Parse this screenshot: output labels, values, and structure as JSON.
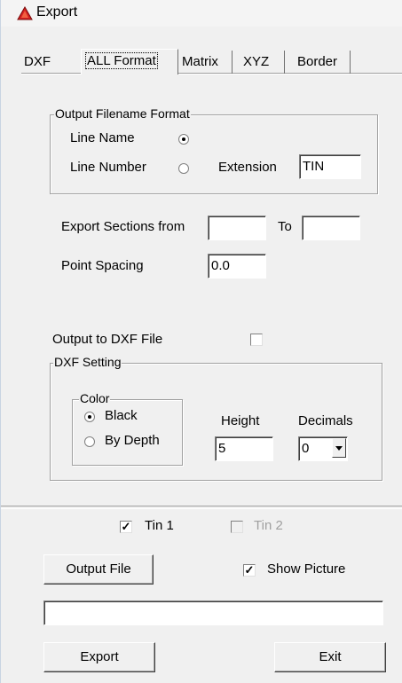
{
  "window": {
    "title": "Export",
    "icon": "triangle-app-icon"
  },
  "tabs": [
    "DXF",
    "ALL Format",
    "Matrix",
    "XYZ",
    "Border"
  ],
  "active_tab": "ALL Format",
  "output_filename_format": {
    "legend": "Output Filename Format",
    "line_name_label": "Line Name",
    "line_number_label": "Line Number",
    "selected": "Line Name",
    "extension_label": "Extension",
    "extension_value": "TIN"
  },
  "export_sections": {
    "label": "Export Sections from",
    "from_value": "",
    "to_label": "To",
    "to_value": ""
  },
  "point_spacing": {
    "label": "Point Spacing",
    "value": "0.0"
  },
  "output_dxf": {
    "label": "Output to DXF File",
    "checked": false
  },
  "dxf_setting": {
    "legend": "DXF Setting",
    "color_legend": "Color",
    "black_label": "Black",
    "by_depth_label": "By Depth",
    "color_selected": "Black",
    "height_label": "Height",
    "height_value": "5",
    "decimals_label": "Decimals",
    "decimals_value": "0"
  },
  "tin1": {
    "label": "Tin 1",
    "checked": true
  },
  "tin2": {
    "label": "Tin 2",
    "checked": false,
    "disabled": true
  },
  "output_file_button": "Output File",
  "show_picture": {
    "label": "Show Picture",
    "checked": true
  },
  "file_path_value": "",
  "export_button": "Export",
  "exit_button": "Exit",
  "colors": {
    "icon_red": "#d42020",
    "background": "#f0f0f0"
  }
}
